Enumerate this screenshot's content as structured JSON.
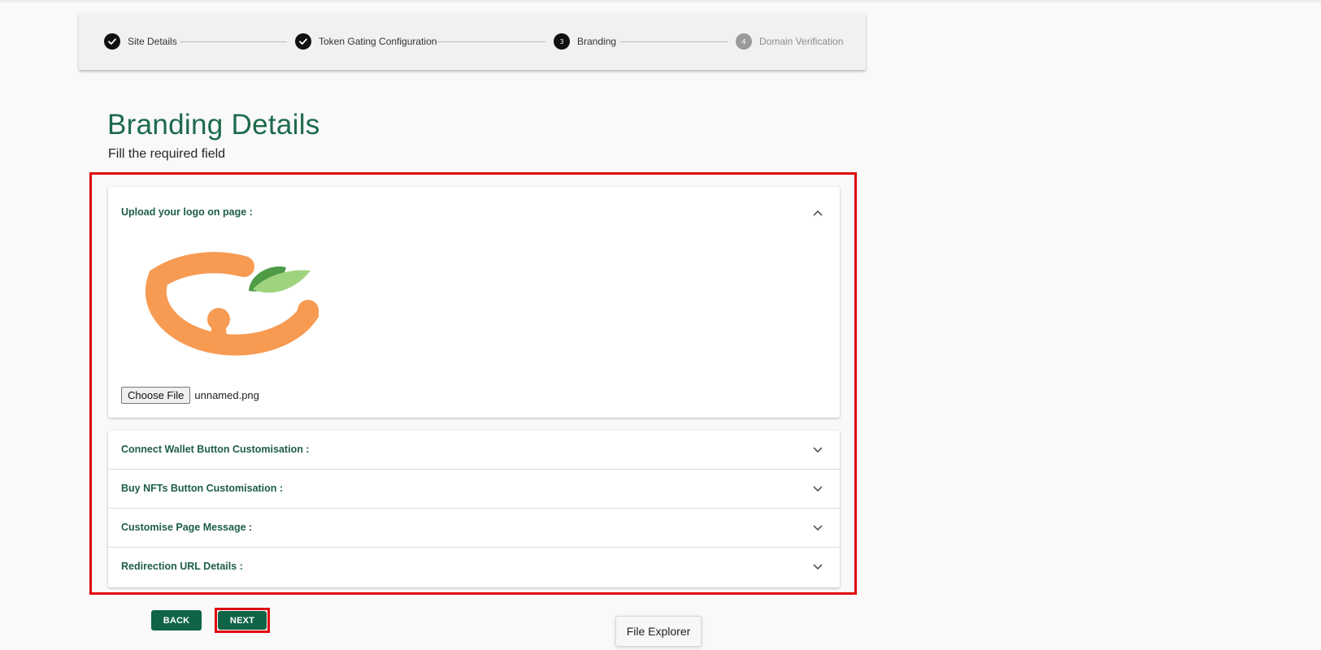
{
  "stepper": {
    "steps": [
      {
        "number": "",
        "label": "Site Details",
        "status": "completed"
      },
      {
        "number": "",
        "label": "Token Gating Configuration",
        "status": "completed"
      },
      {
        "number": "3",
        "label": "Branding",
        "status": "active"
      },
      {
        "number": "4",
        "label": "Domain Verification",
        "status": "pending"
      }
    ]
  },
  "page": {
    "title": "Branding Details",
    "subtitle": "Fill the required field"
  },
  "logo_section": {
    "label": "Upload your logo on page :",
    "choose_file_label": "Choose File",
    "file_name": "unnamed.png"
  },
  "sections": [
    {
      "label": "Connect Wallet Button Customisation :"
    },
    {
      "label": "Buy NFTs Button Customisation :"
    },
    {
      "label": "Customise Page Message :"
    },
    {
      "label": "Redirection URL Details :"
    }
  ],
  "buttons": {
    "back": "BACK",
    "next": "NEXT"
  },
  "tooltip": {
    "text": "File Explorer"
  },
  "colors": {
    "primary": "#0f6446",
    "heading": "#1d6a4c",
    "highlight": "#e0070d",
    "logo_orange": "#f79a52",
    "logo_leaf_dark": "#4e9a45",
    "logo_leaf_light": "#9fd47f"
  }
}
